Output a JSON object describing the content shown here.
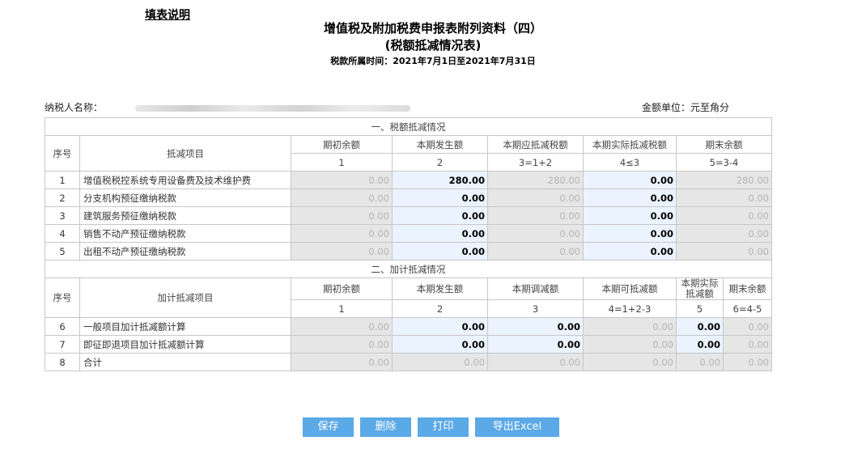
{
  "help_link": "填表说明",
  "title_line1": "增值税及附加税费申报表附列资料（四）",
  "title_line2": "(税额抵减情况表)",
  "period": "税款所属时间：2021年7月1日至2021年7月31日",
  "taxpayer_label": "纳税人名称：",
  "unit_label": "金额单位：元至角分",
  "section1": {
    "title": "一、税额抵减情况",
    "headers": [
      "序号",
      "抵减项目",
      "期初余额",
      "本期发生额",
      "本期应抵减税额",
      "本期实际抵减税额",
      "期末余额"
    ],
    "formulas": [
      "1",
      "2",
      "3=1+2",
      "4≤3",
      "5=3-4"
    ],
    "rows": [
      {
        "no": "1",
        "name": "增值税税控系统专用设备费及技术维护费",
        "v": [
          "0.00",
          "280.00",
          "280.00",
          "0.00",
          "280.00"
        ]
      },
      {
        "no": "2",
        "name": "分支机构预征缴纳税款",
        "v": [
          "0.00",
          "0.00",
          "0.00",
          "0.00",
          "0.00"
        ]
      },
      {
        "no": "3",
        "name": "建筑服务预征缴纳税款",
        "v": [
          "0.00",
          "0.00",
          "0.00",
          "0.00",
          "0.00"
        ]
      },
      {
        "no": "4",
        "name": "销售不动产预征缴纳税款",
        "v": [
          "0.00",
          "0.00",
          "0.00",
          "0.00",
          "0.00"
        ]
      },
      {
        "no": "5",
        "name": "出租不动产预征缴纳税款",
        "v": [
          "0.00",
          "0.00",
          "0.00",
          "0.00",
          "0.00"
        ]
      }
    ]
  },
  "section2": {
    "title": "二、加计抵减情况",
    "headers": [
      "序号",
      "加计抵减项目",
      "期初余额",
      "本期发生额",
      "本期调减额",
      "本期可抵减额",
      "本期实际抵减额",
      "期末余额"
    ],
    "formulas": [
      "1",
      "2",
      "3",
      "4=1+2-3",
      "5",
      "6=4-5"
    ],
    "rows": [
      {
        "no": "6",
        "name": "一般项目加计抵减额计算",
        "v": [
          "0.00",
          "0.00",
          "0.00",
          "0.00",
          "0.00",
          "0.00"
        ]
      },
      {
        "no": "7",
        "name": "即征即退项目加计抵减额计算",
        "v": [
          "0.00",
          "0.00",
          "0.00",
          "0.00",
          "0.00",
          "0.00"
        ]
      },
      {
        "no": "8",
        "name": "合计",
        "v": [
          "0.00",
          "0.00",
          "0.00",
          "0.00",
          "0.00",
          "0.00"
        ]
      }
    ]
  },
  "buttons": {
    "save": "保存",
    "delete": "删除",
    "print": "打印",
    "export": "导出Excel"
  },
  "colors": {
    "button": "#5ba9e6",
    "editable_cell": "#eaf3fe",
    "readonly_cell": "#e6e6e6",
    "border": "#c7c7c7"
  }
}
